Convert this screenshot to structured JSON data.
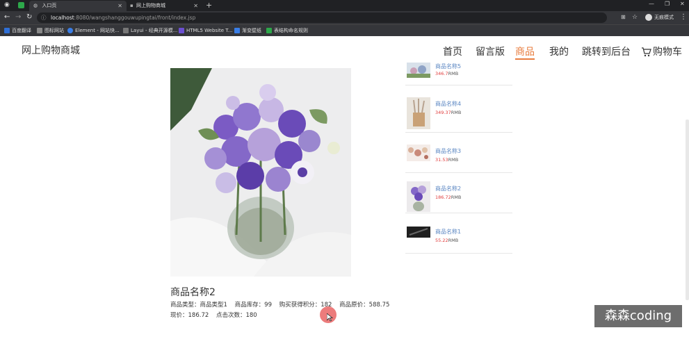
{
  "browser": {
    "tabs": [
      {
        "title": "入口页",
        "active": true
      },
      {
        "title": "网上购物商城",
        "active": false
      }
    ],
    "url_host": "localhost",
    "url_rest": ":8080/wangshanggouwupingtai/front/index.jsp",
    "incognito_label": "无痕模式",
    "bookmarks": [
      {
        "label": "百度翻译",
        "color": "#2f6fd6"
      },
      {
        "label": "图标网站",
        "color": "#888888"
      },
      {
        "label": "Element - 网站快...",
        "color": "#3a7ee6"
      },
      {
        "label": "Layui - 经典开源模...",
        "color": "#777777"
      },
      {
        "label": "HTML5 Website T...",
        "color": "#6b4fd1"
      },
      {
        "label": "渐变壁纸",
        "color": "#3a7ee6"
      },
      {
        "label": "表结构命名规则",
        "color": "#2da84a"
      }
    ]
  },
  "site": {
    "logo": "网上购物商城",
    "nav": [
      {
        "label": "首页"
      },
      {
        "label": "留言版"
      },
      {
        "label": "商品",
        "active": true
      },
      {
        "label": "我的"
      },
      {
        "label": "跳转到后台"
      },
      {
        "label": "购物车"
      }
    ]
  },
  "product": {
    "title": "商品名称2",
    "type_label": "商品类型：",
    "type_value": "商品类型1",
    "stock_label": "商品库存：",
    "stock_value": "99",
    "points_label": "购买获得积分：",
    "points_value": "182",
    "orig_price_label": "商品原价：",
    "orig_price_value": "588.75",
    "price_label": "现价：",
    "price_value": "186.72",
    "clicks_label": "点击次数：",
    "clicks_value": "180"
  },
  "sidebar_items": [
    {
      "name": "商品名称5",
      "price": "346.7",
      "unit": "RMB"
    },
    {
      "name": "商品名称4",
      "price": "349.37",
      "unit": "RMB"
    },
    {
      "name": "商品名称3",
      "price": "31.53",
      "unit": "RMB"
    },
    {
      "name": "商品名称2",
      "price": "186.72",
      "unit": "RMB"
    },
    {
      "name": "商品名称1",
      "price": "55.22",
      "unit": "RMB"
    }
  ],
  "watermark": "森森coding",
  "colors": {
    "accent": "#e87c3e",
    "price": "#e03b3b",
    "link": "#5a86c2"
  }
}
